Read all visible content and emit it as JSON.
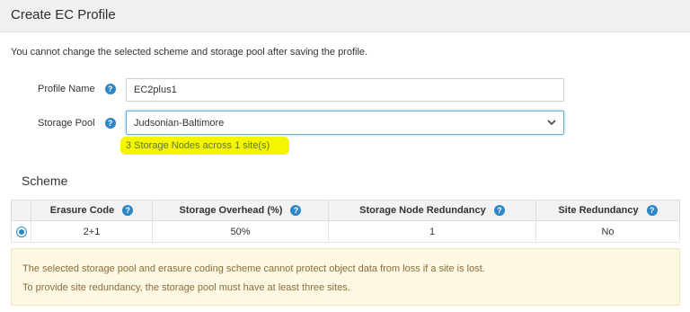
{
  "header": {
    "title": "Create EC Profile"
  },
  "intro": "You cannot change the selected scheme and storage pool after saving the profile.",
  "form": {
    "profile_name": {
      "label": "Profile Name",
      "value": "EC2plus1"
    },
    "storage_pool": {
      "label": "Storage Pool",
      "value": "Judsonian-Baltimore",
      "note": "3 Storage Nodes across 1 site(s)"
    }
  },
  "scheme": {
    "title": "Scheme",
    "columns": [
      "Erasure Code",
      "Storage Overhead (%)",
      "Storage Node Redundancy",
      "Site Redundancy"
    ],
    "rows": [
      {
        "selected": true,
        "erasure_code": "2+1",
        "overhead": "50%",
        "node_redundancy": "1",
        "site_redundancy": "No"
      }
    ]
  },
  "warning": {
    "line1": "The selected storage pool and erasure coding scheme cannot protect object data from loss if a site is lost.",
    "line2": "To provide site redundancy, the storage pool must have at least three sites."
  },
  "colors": {
    "accent": "#2f86c4",
    "highlight": "#f5f500",
    "note_text": "#5c7a26",
    "warning_bg": "#fcf8e3",
    "warning_text": "#8a6d3b"
  }
}
